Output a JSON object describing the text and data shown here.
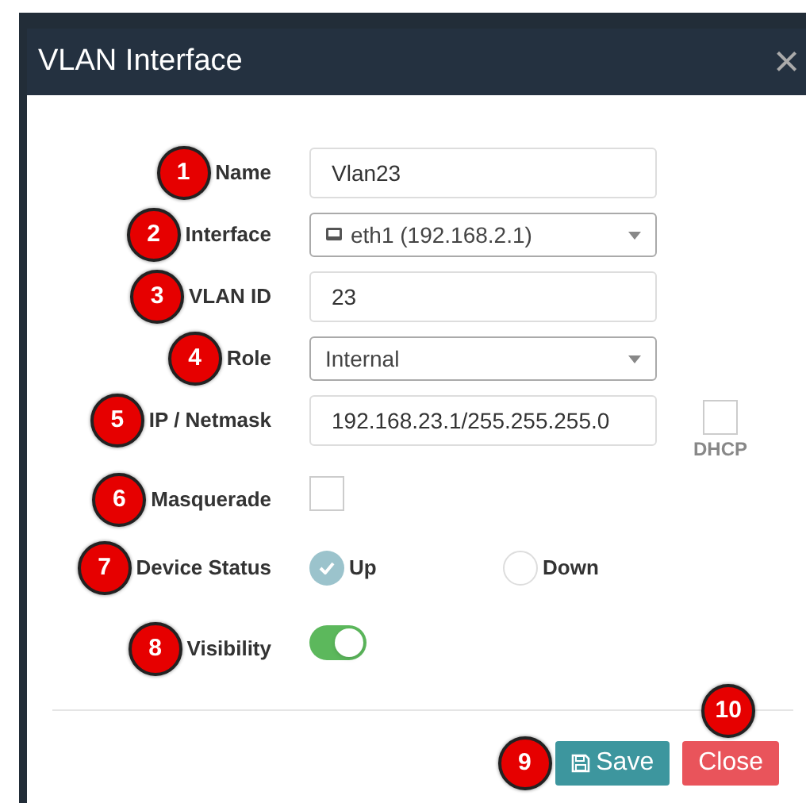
{
  "dialog": {
    "title": "VLAN Interface",
    "close_symbol": "×"
  },
  "rows": [
    {
      "kind": "text",
      "badge": "1",
      "label": "Name",
      "value": "Vlan23"
    },
    {
      "kind": "select",
      "badge": "2",
      "label": "Interface",
      "value": "eth1 (192.168.2.1)",
      "icon": true
    },
    {
      "kind": "text",
      "badge": "3",
      "label": "VLAN ID",
      "value": "23"
    },
    {
      "kind": "select",
      "badge": "4",
      "label": "Role",
      "value": "Internal",
      "icon": false
    },
    {
      "kind": "text",
      "badge": "5",
      "label": "IP / Netmask",
      "value": "192.168.23.1/255.255.255.0",
      "extra": {
        "label": "DHCP",
        "checked": false
      }
    },
    {
      "kind": "checkbox",
      "badge": "6",
      "label": "Masquerade",
      "checked": false
    },
    {
      "kind": "radio",
      "badge": "7",
      "label": "Device Status",
      "options": [
        {
          "label": "Up",
          "selected": true
        },
        {
          "label": "Down",
          "selected": false
        }
      ]
    },
    {
      "kind": "toggle",
      "badge": "8",
      "label": "Visibility",
      "on": true
    }
  ],
  "buttons": [
    {
      "kind": "save",
      "label": "Save",
      "badge": "9"
    },
    {
      "kind": "close",
      "label": "Close",
      "badge": "10"
    }
  ]
}
